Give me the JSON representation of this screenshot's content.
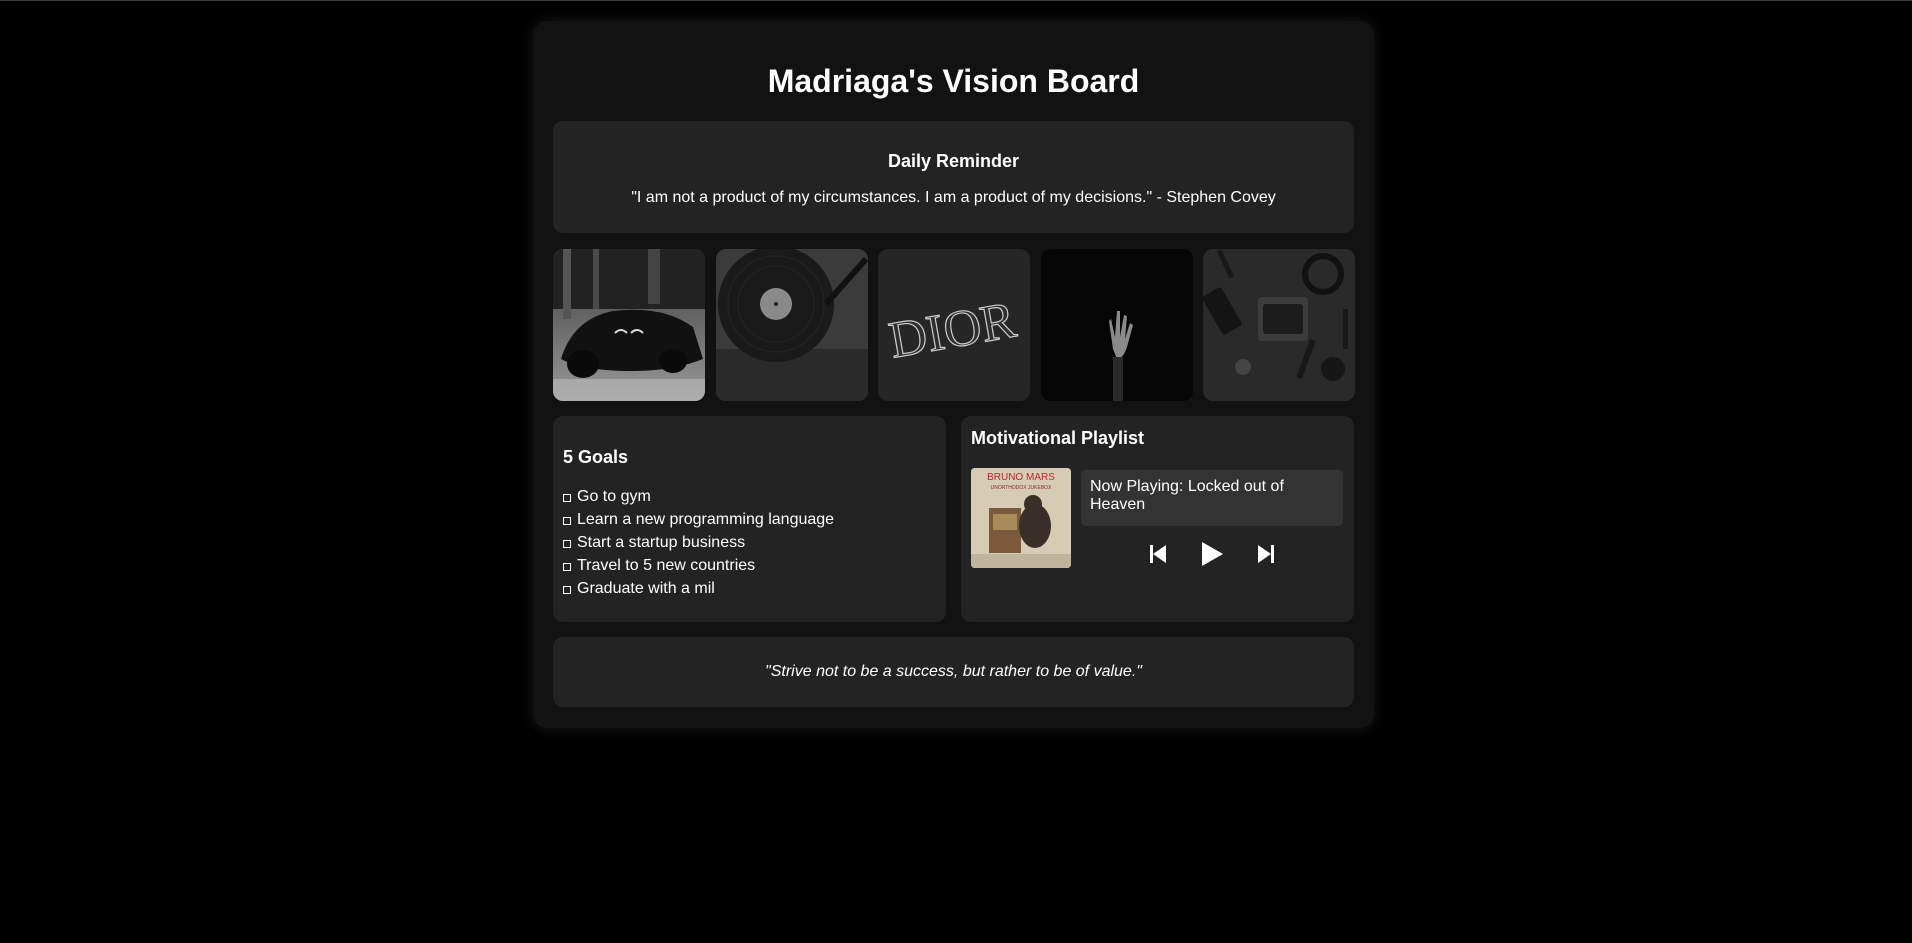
{
  "board": {
    "title": "Madriaga's Vision Board"
  },
  "reminder": {
    "heading": "Daily Reminder",
    "quote": "\"I am not a product of my circumstances. I am a product of my decisions.\" - Stephen Covey"
  },
  "images": [
    {
      "name": "black sports car"
    },
    {
      "name": "vinyl record player"
    },
    {
      "name": "DIOR sign",
      "text": "DIOR"
    },
    {
      "name": "hand in darkness"
    },
    {
      "name": "black gadgets flatlay"
    }
  ],
  "goals": {
    "heading": "5 Goals",
    "items": [
      "Go to gym",
      "Learn a new programming language",
      "Start a startup business",
      "Travel to 5 new countries",
      "Graduate with a mil"
    ]
  },
  "playlist": {
    "heading": "Motivational Playlist",
    "album_artist": "BRUNO MARS",
    "album_title": "UNORTHODOX JUKEBOX",
    "now_playing": "Now Playing: Locked out of Heaven",
    "controls": [
      "previous-icon",
      "play-icon",
      "next-icon"
    ]
  },
  "footer": {
    "quote": "\"Strive not to be a success, but rather to be of value.\""
  },
  "colors": {
    "background": "#000000",
    "board": "#121212",
    "panel": "#232323",
    "now_playing_box": "#333333",
    "text": "#ffffff"
  }
}
